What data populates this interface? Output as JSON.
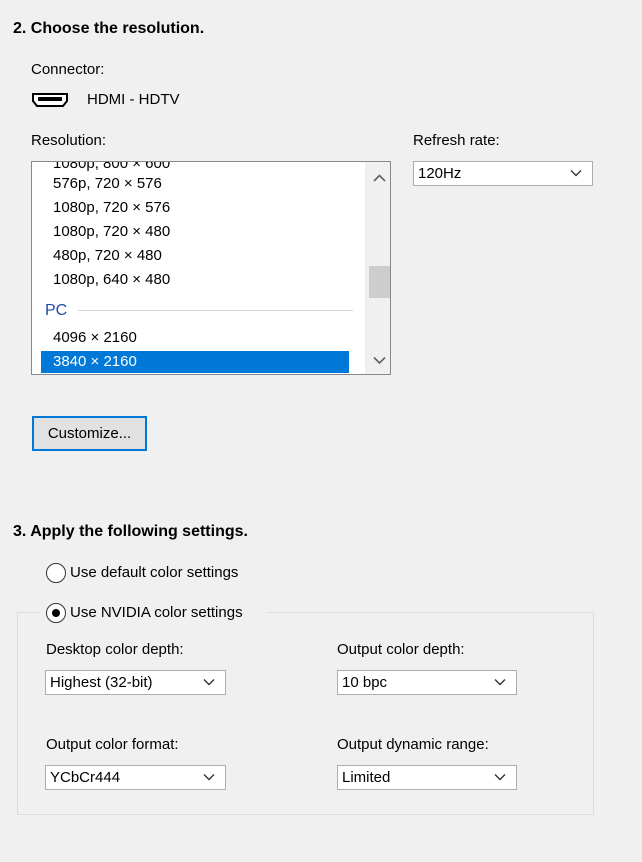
{
  "section2": {
    "title": "2. Choose the resolution.",
    "connector_label": "Connector:",
    "connector_value": "HDMI - HDTV",
    "resolution_label": "Resolution:",
    "refresh_label": "Refresh rate:",
    "refresh_value": "120Hz",
    "resolutions": {
      "partial_top": "1080p, 800 × 600",
      "items": [
        "576p, 720 × 576",
        "1080p, 720 × 576",
        "1080p, 720 × 480",
        "480p, 720 × 480",
        "1080p, 640 × 480"
      ],
      "group_pc": "PC",
      "pc_items": [
        "4096 × 2160",
        "3840 × 2160"
      ],
      "selected": "3840 × 2160"
    },
    "customize_label": "Customize..."
  },
  "section3": {
    "title": "3. Apply the following settings.",
    "radio_default": "Use default color settings",
    "radio_nvidia": "Use NVIDIA color settings",
    "desktop_depth_label": "Desktop color depth:",
    "desktop_depth_value": "Highest (32-bit)",
    "output_depth_label": "Output color depth:",
    "output_depth_value": "10 bpc",
    "output_format_label": "Output color format:",
    "output_format_value": "YCbCr444",
    "output_range_label": "Output dynamic range:",
    "output_range_value": "Limited"
  },
  "colors": {
    "accent": "#0078d7",
    "group_header": "#1f4bad"
  }
}
